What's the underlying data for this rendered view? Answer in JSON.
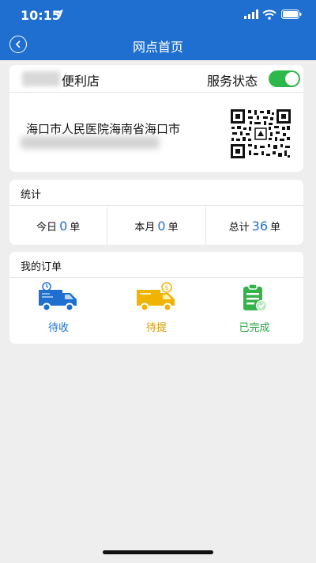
{
  "status_bar": {
    "time": "10:15"
  },
  "nav": {
    "title": "网点首页"
  },
  "store": {
    "name_suffix": "便利店",
    "service_status_label": "服务状态",
    "service_on": true,
    "address": "海口市人民医院海南省海口市"
  },
  "stats": {
    "section_title": "统计",
    "today": {
      "label": "今日",
      "value": "0",
      "unit": "单"
    },
    "month": {
      "label": "本月",
      "value": "0",
      "unit": "单"
    },
    "total": {
      "label": "总计",
      "value": "36",
      "unit": "单"
    }
  },
  "orders": {
    "section_title": "我的订单",
    "items": [
      {
        "label": "待收",
        "icon": "truck-blue-icon",
        "color": "#1f6fd1"
      },
      {
        "label": "待提",
        "icon": "truck-orange-icon",
        "color": "#e0a100"
      },
      {
        "label": "已完成",
        "icon": "clipboard-check-icon",
        "color": "#27a844"
      }
    ]
  },
  "colors": {
    "primary": "#1f6fd1",
    "toggle_on": "#2db84b",
    "background": "#eeeeee"
  }
}
